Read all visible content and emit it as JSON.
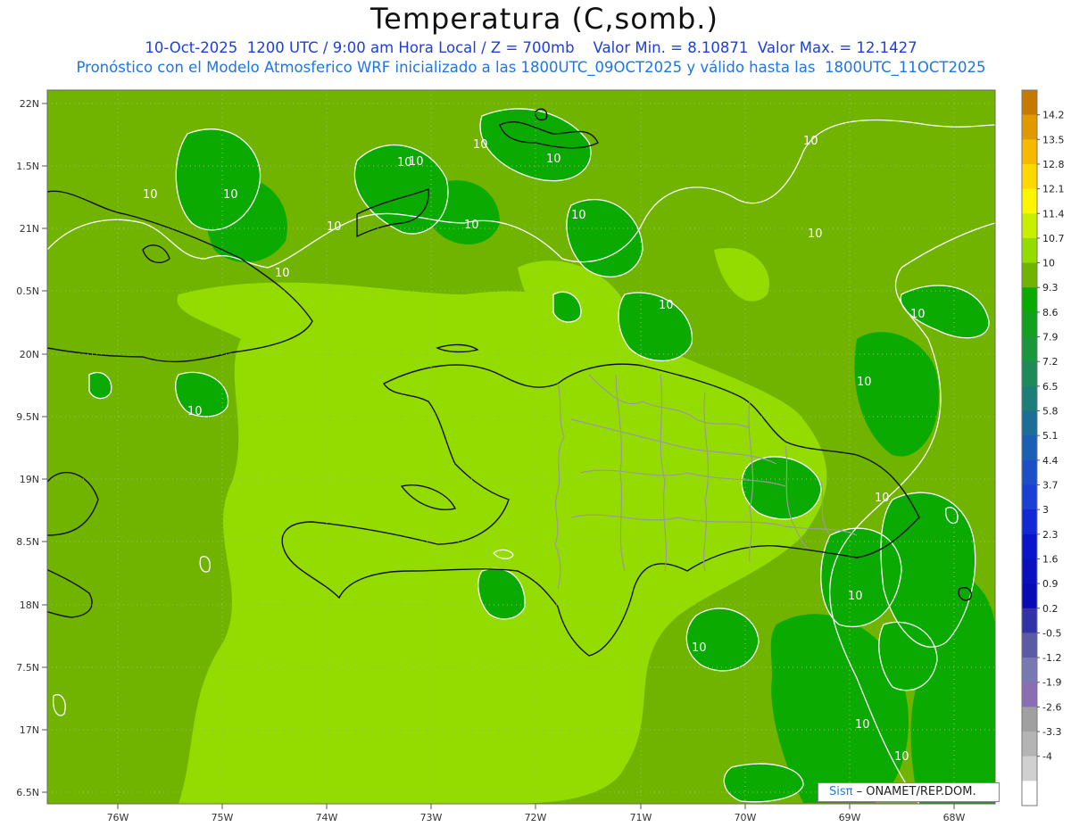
{
  "header": {
    "title": "Temperatura (C,somb.)",
    "line1": "10-Oct-2025  1200 UTC / 9:00 am Hora Local / Z = 700mb    Valor Min. = 8.10871  Valor Max. = 12.1427",
    "line2": "Pronóstico con el Modelo Atmosferico WRF inicializado a las 1800UTC_09OCT2025 y válido hasta las  1800UTC_11OCT2025"
  },
  "axes": {
    "lat_labels": [
      "22N",
      "1.5N",
      "21N",
      "0.5N",
      "20N",
      "9.5N",
      "19N",
      "8.5N",
      "18N",
      "7.5N",
      "17N",
      "6.5N"
    ],
    "lon_labels": [
      "76W",
      "75W",
      "74W",
      "73W",
      "72W",
      "71W",
      "70W",
      "69W",
      "68W"
    ]
  },
  "colorbar": {
    "labels": [
      "14.2",
      "13.5",
      "12.8",
      "12.1",
      "11.4",
      "10.7",
      "10",
      "9.3",
      "8.6",
      "7.9",
      "7.2",
      "6.5",
      "5.8",
      "5.1",
      "4.4",
      "3.7",
      "3",
      "2.3",
      "1.6",
      "0.9",
      "0.2",
      "-0.5",
      "-1.2",
      "-1.9",
      "-2.6",
      "-3.3",
      "-4"
    ],
    "colors": [
      "#c47a00",
      "#e09a00",
      "#f5b900",
      "#ffd800",
      "#fff500",
      "#c6f000",
      "#94dc00",
      "#70b400",
      "#0aaa00",
      "#12a01e",
      "#1a963c",
      "#1e8a5a",
      "#1e7d78",
      "#1c6e96",
      "#1a5fb4",
      "#1a4fc8",
      "#1a3fd4",
      "#1228d2",
      "#0a14c8",
      "#0a10be",
      "#0a0ab4",
      "#3232a8",
      "#5a5aa5",
      "#7a78b0",
      "#8a6eb4",
      "#a0a0a0",
      "#b4b4b4",
      "#d0d0d0",
      "#ffffff"
    ]
  },
  "contour_labels": [
    "10",
    "10",
    "10",
    "10",
    "10",
    "10",
    "10",
    "10",
    "10",
    "10",
    "10",
    "10",
    "10",
    "10",
    "10",
    "10",
    "10",
    "10",
    "10",
    "10",
    "10"
  ],
  "credit": {
    "sis": "Sisπ",
    "text": " – ONAMET/REP.DOM."
  }
}
